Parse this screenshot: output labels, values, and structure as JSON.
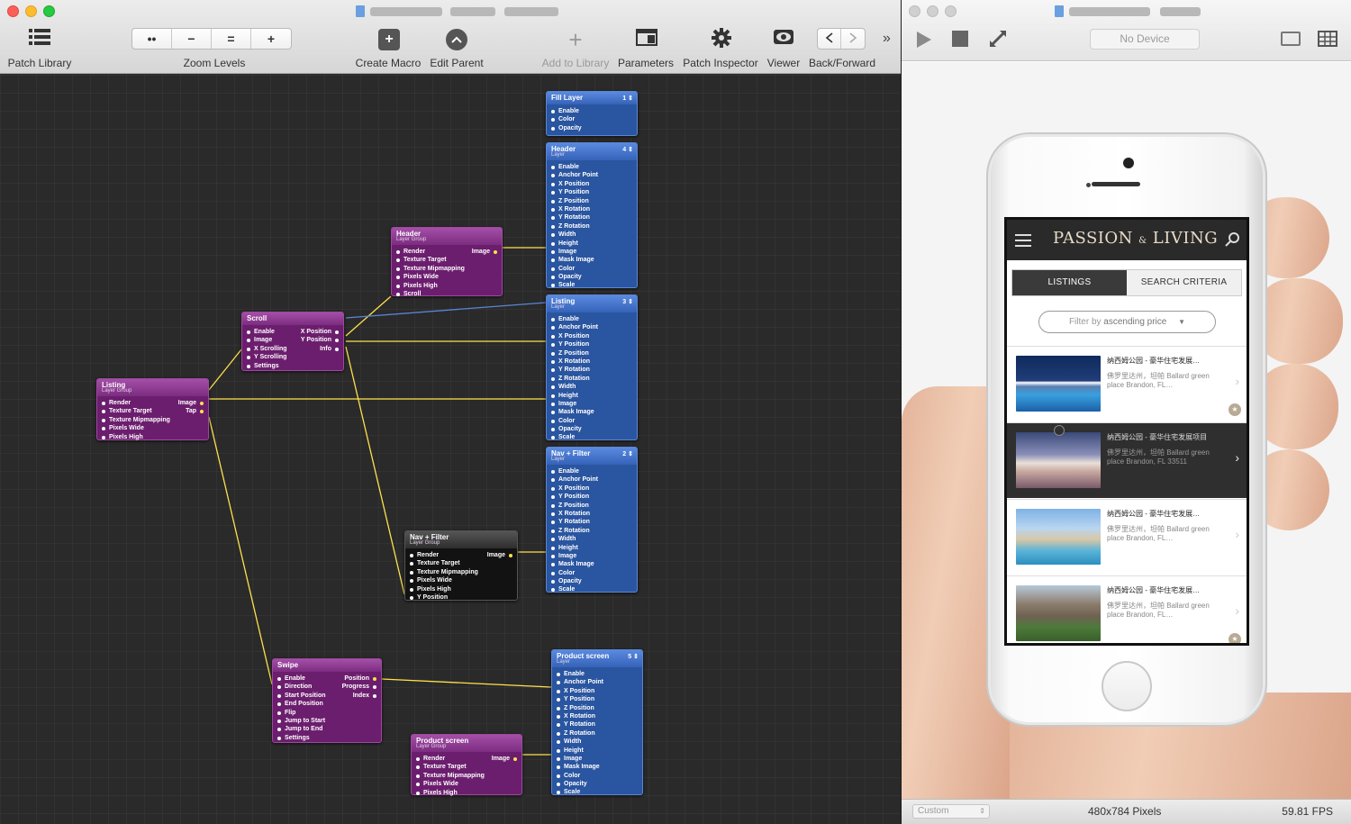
{
  "editor": {
    "toolbar": {
      "patch_library": "Patch Library",
      "zoom_levels": "Zoom Levels",
      "zoom_fit": "••",
      "zoom_out": "−",
      "zoom_actual": "=",
      "zoom_in": "+",
      "create_macro": "Create Macro",
      "edit_parent": "Edit Parent",
      "add_to_library": "Add to Library",
      "parameters": "Parameters",
      "patch_inspector": "Patch Inspector",
      "viewer": "Viewer",
      "back_forward": "Back/Forward",
      "overflow": "»"
    },
    "patches": {
      "fill_layer": {
        "title": "Fill Layer",
        "num": "1 ⇕",
        "inputs": [
          "Enable",
          "Color",
          "Opacity"
        ]
      },
      "header_layer": {
        "title": "Header",
        "sub": "Layer",
        "num": "4 ⇕",
        "inputs": [
          "Enable",
          "Anchor Point",
          "X Position",
          "Y Position",
          "Z Position",
          "X Rotation",
          "Y Rotation",
          "Z Rotation",
          "Width",
          "Height",
          "Image",
          "Mask Image",
          "Color",
          "Opacity",
          "Scale"
        ]
      },
      "header_group": {
        "title": "Header",
        "sub": "Layer Group",
        "inputs": [
          "Render",
          "Texture Target",
          "Texture Mipmapping",
          "Pixels Wide",
          "Pixels High",
          "Scroll"
        ],
        "outputs": [
          "Image"
        ]
      },
      "scroll": {
        "title": "Scroll",
        "inputs": [
          "Enable",
          "Image",
          "X Scrolling",
          "Y Scrolling",
          "Settings"
        ],
        "outputs": [
          "X Position",
          "Y Position",
          "Info"
        ]
      },
      "listing_group": {
        "title": "Listing",
        "sub": "Layer Group",
        "inputs": [
          "Render",
          "Texture Target",
          "Texture Mipmapping",
          "Pixels Wide",
          "Pixels High"
        ],
        "outputs": [
          "Image",
          "Tap"
        ]
      },
      "listing_layer": {
        "title": "Listing",
        "sub": "Layer",
        "num": "3 ⇕",
        "inputs": [
          "Enable",
          "Anchor Point",
          "X Position",
          "Y Position",
          "Z Position",
          "X Rotation",
          "Y Rotation",
          "Z Rotation",
          "Width",
          "Height",
          "Image",
          "Mask Image",
          "Color",
          "Opacity",
          "Scale"
        ]
      },
      "navfilter_layer": {
        "title": "Nav + Filter",
        "sub": "Layer",
        "num": "2 ⇕",
        "inputs": [
          "Enable",
          "Anchor Point",
          "X Position",
          "Y Position",
          "Z Position",
          "X Rotation",
          "Y Rotation",
          "Z Rotation",
          "Width",
          "Height",
          "Image",
          "Mask Image",
          "Color",
          "Opacity",
          "Scale"
        ]
      },
      "navfilter_group": {
        "title": "Nav + Filter",
        "sub": "Layer Group",
        "inputs": [
          "Render",
          "Texture Target",
          "Texture Mipmapping",
          "Pixels Wide",
          "Pixels High",
          "Y Position"
        ],
        "outputs": [
          "Image"
        ]
      },
      "swipe": {
        "title": "Swipe",
        "inputs": [
          "Enable",
          "Direction",
          "Start Position",
          "End Position",
          "Flip",
          "Jump to Start",
          "Jump to End",
          "Settings"
        ],
        "outputs": [
          "Position",
          "Progress",
          "Index"
        ]
      },
      "product_layer": {
        "title": "Product screen",
        "sub": "Layer",
        "num": "5 ⇕",
        "inputs": [
          "Enable",
          "Anchor Point",
          "X Position",
          "Y Position",
          "Z Position",
          "X Rotation",
          "Y Rotation",
          "Z Rotation",
          "Width",
          "Height",
          "Image",
          "Mask Image",
          "Color",
          "Opacity",
          "Scale"
        ]
      },
      "product_group": {
        "title": "Product screen",
        "sub": "Layer Group",
        "inputs": [
          "Render",
          "Texture Target",
          "Texture Mipmapping",
          "Pixels Wide",
          "Pixels High"
        ],
        "outputs": [
          "Image"
        ]
      }
    }
  },
  "viewer": {
    "device": "No Device",
    "status": {
      "preset": "Custom",
      "size": "480x784 Pixels",
      "fps": "59.81 FPS"
    },
    "app": {
      "brand_a": "PASSION",
      "brand_amp": "&",
      "brand_b": "LIVING",
      "tab_listings": "LISTINGS",
      "tab_search": "SEARCH CRITERIA",
      "filter_prefix": "Filter by ",
      "filter_value": "ascending price",
      "listings": [
        {
          "title": "纳西姆公园 - 豪华住宅发展…",
          "desc": "佛罗里达州，坦帕 Ballard green place Brandon, FL…"
        },
        {
          "title": "纳西姆公园 - 豪华住宅发展项目",
          "desc": "佛罗里达州，坦帕 Ballard green place Brandon, FL 33511"
        },
        {
          "title": "纳西姆公园 - 豪华住宅发展…",
          "desc": "佛罗里达州，坦帕 Ballard green place Brandon, FL…"
        },
        {
          "title": "纳西姆公园 - 豪华住宅发展…",
          "desc": "佛罗里达州，坦帕 Ballard green place Brandon, FL…"
        }
      ]
    }
  },
  "colors": {
    "patch_purple": "#6c1e6e",
    "patch_blue": "#2a55a0",
    "wire_yellow": "#ffe14d",
    "wire_blue": "#5a86d6"
  }
}
